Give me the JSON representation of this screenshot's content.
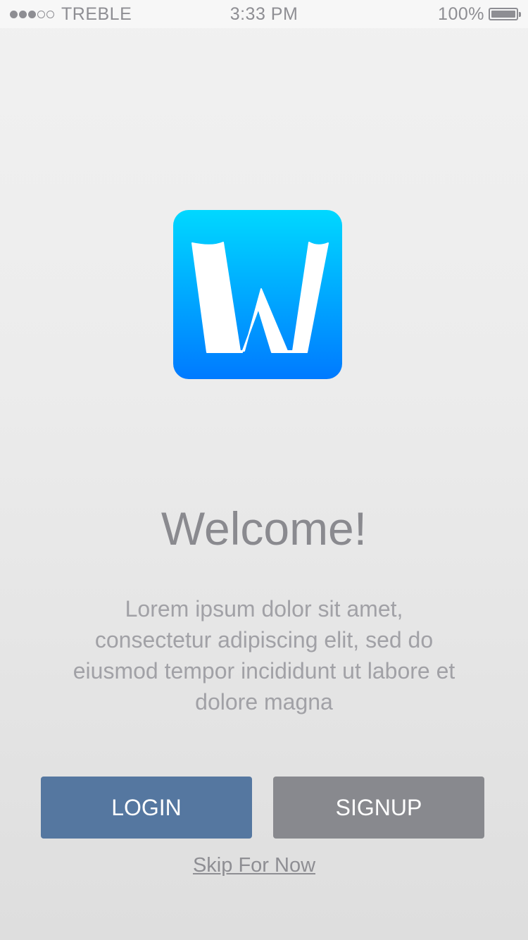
{
  "status_bar": {
    "carrier": "TREBLE",
    "time": "3:33 PM",
    "battery_percent": "100%",
    "battery_level": 1.0,
    "signal_bars_filled": 3,
    "signal_bars_total": 5
  },
  "logo": {
    "letter": "W",
    "icon": "app-logo-icon",
    "gradient_top": "#00d8ff",
    "gradient_bottom": "#007aff"
  },
  "welcome": {
    "title": "Welcome!",
    "body": "Lorem ipsum dolor sit amet, consectetur adipiscing elit, sed do eiusmod tempor incididunt ut labore et dolore magna"
  },
  "actions": {
    "login_label": "LOGIN",
    "signup_label": "SIGNUP",
    "skip_label": "Skip For Now"
  },
  "colors": {
    "login_button": "#5577a0",
    "signup_button": "#88898e",
    "title_text": "#8a8a8f"
  }
}
